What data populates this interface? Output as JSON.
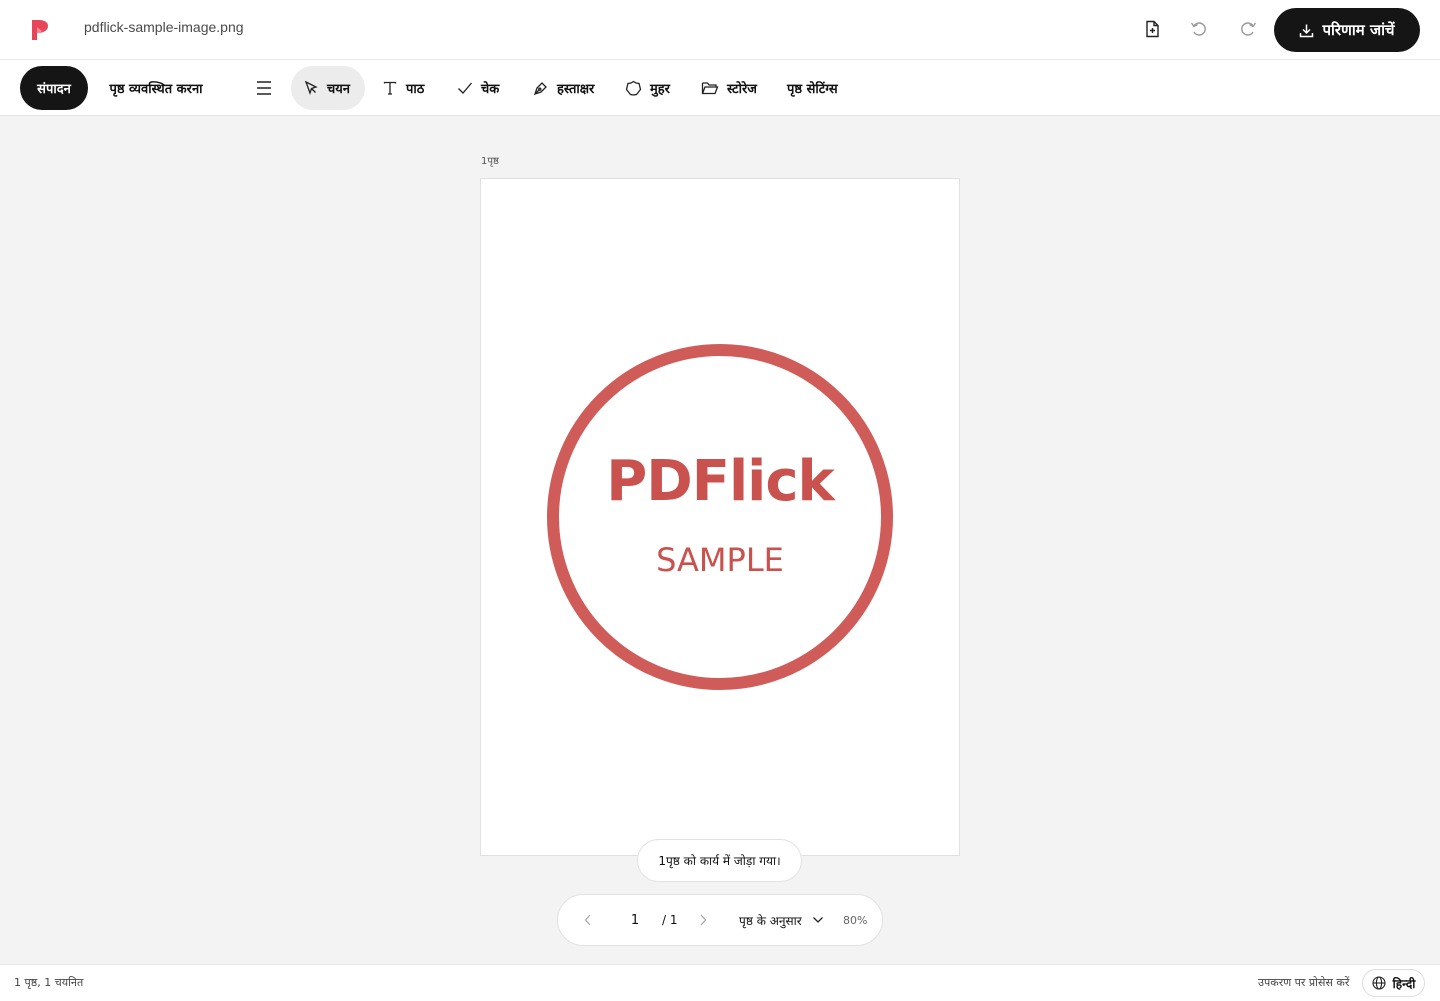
{
  "header": {
    "filename": "pdflick-sample-image.png",
    "primary_button_label": "परिणाम जांचें",
    "icons": [
      "add-page-icon",
      "undo-icon",
      "redo-icon",
      "download-icon"
    ]
  },
  "toolbar": {
    "tabs": [
      {
        "label": "संपादन",
        "active": true
      },
      {
        "label": "पृष्ठ व्यवस्थित करना",
        "active": false
      }
    ],
    "tools": [
      {
        "label": "चयन",
        "icon": "pointer-icon",
        "active": true
      },
      {
        "label": "पाठ",
        "icon": "text-icon",
        "active": false
      },
      {
        "label": "चेक",
        "icon": "check-icon",
        "active": false
      },
      {
        "label": "हस्ताक्षर",
        "icon": "pen-icon",
        "active": false
      },
      {
        "label": "मुहर",
        "icon": "seal-icon",
        "active": false
      },
      {
        "label": "स्टोरेज",
        "icon": "folder-icon",
        "active": false
      },
      {
        "label": "पृष्ठ सेटिंग्स",
        "icon": "",
        "active": false
      }
    ]
  },
  "document": {
    "page_label": "1पृष्ठ",
    "stamp_title": "PDFlick",
    "stamp_subtitle": "SAMPLE",
    "stamp_color": "#cf5c58"
  },
  "toast": "1पृष्ठ को कार्य में जोड़ा गया।",
  "pager": {
    "current_page": "1",
    "total_pages": "/ 1",
    "fit_mode": "पृष्ठ के अनुसार",
    "zoom": "80%"
  },
  "status": {
    "left": "1 पृष्ठ, 1 चयनित",
    "right": "उपकरण पर प्रोसेस करें",
    "language": "हिन्दी"
  },
  "colors": {
    "accent": "#e8455a",
    "dark_button": "#151515",
    "stamp": "#cf5c58"
  }
}
